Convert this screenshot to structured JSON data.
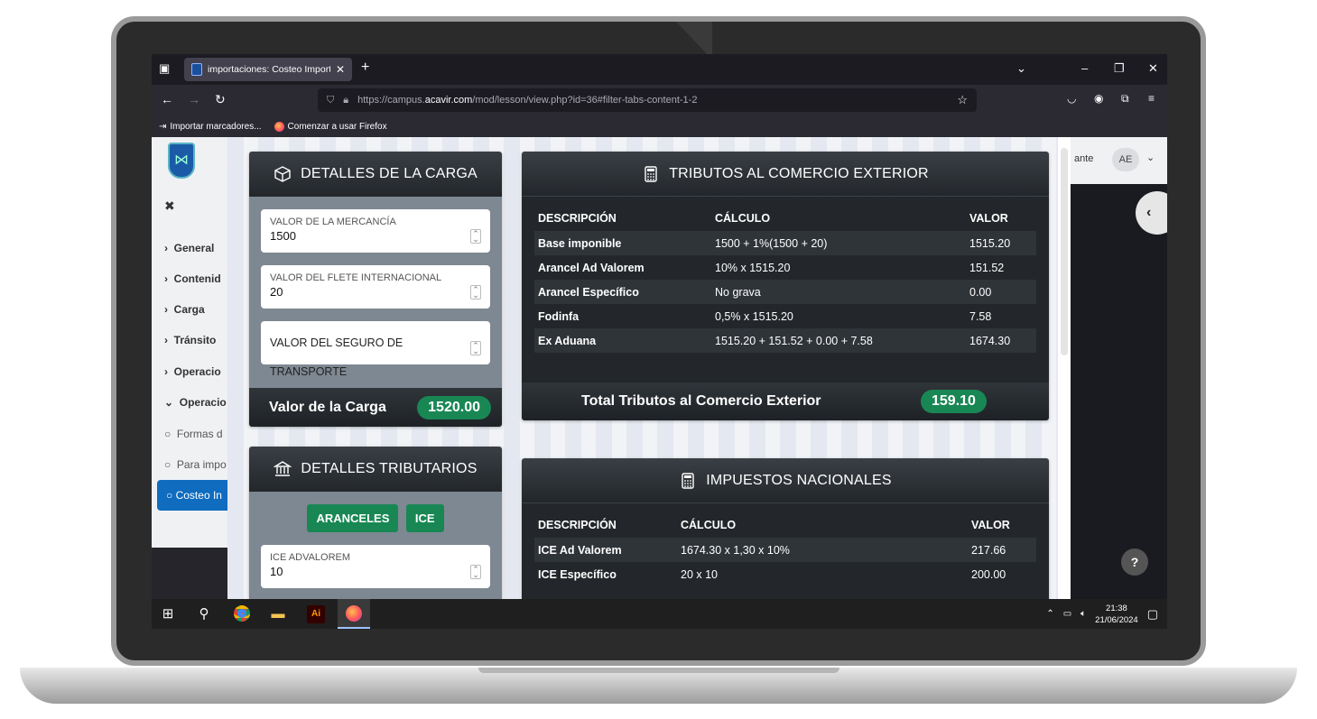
{
  "browser": {
    "tab_title": "importaciones: Costeo Importa",
    "url_prefix": "https://campus.",
    "url_host": "acavir.com",
    "url_path": "/mod/lesson/view.php?id=36#filter-tabs-content-1-2",
    "bookmarks": [
      "Importar marcadores...",
      "Comenzar a usar Firefox"
    ]
  },
  "moodle": {
    "menu": [
      {
        "label": "General"
      },
      {
        "label": "Contenid"
      },
      {
        "label": "Carga"
      },
      {
        "label": "Tránsito"
      },
      {
        "label": "Operacio"
      },
      {
        "label": "Operacio"
      }
    ],
    "submenu": [
      "Formas d",
      "Para impo"
    ],
    "active_item": "Costeo In",
    "user_role_fragment": "ante",
    "avatar": "AE"
  },
  "carga": {
    "title": "DETALLES DE LA CARGA",
    "fields": [
      {
        "label": "VALOR DE LA MERCANCÍA",
        "value": "1500"
      },
      {
        "label": "VALOR DEL FLETE INTERNACIONAL",
        "value": "20"
      }
    ],
    "seguro_placeholder": "VALOR DEL SEGURO DE TRANSPORTE",
    "total_label": "Valor de la Carga",
    "total_value": "1520.00"
  },
  "tributarios": {
    "title": "DETALLES TRIBUTARIOS",
    "buttons": [
      "ARANCELES",
      "ICE"
    ],
    "field": {
      "label": "ICE ADVALOREM",
      "value": "10"
    }
  },
  "tributos_exterior": {
    "title": "TRIBUTOS AL COMERCIO EXTERIOR",
    "headers": [
      "DESCRIPCIÓN",
      "CÁLCULO",
      "VALOR"
    ],
    "rows": [
      [
        "Base imponible",
        "1500 + 1%(1500 + 20)",
        "1515.20"
      ],
      [
        "Arancel Ad Valorem",
        "10% x 1515.20",
        "151.52"
      ],
      [
        "Arancel Específico",
        "No grava",
        "0.00"
      ],
      [
        "Fodinfa",
        "0,5% x 1515.20",
        "7.58"
      ],
      [
        "Ex Aduana",
        "1515.20 + 151.52 + 0.00 + 7.58",
        "1674.30"
      ]
    ],
    "total_label": "Total Tributos al Comercio Exterior",
    "total_value": "159.10"
  },
  "impuestos_nacionales": {
    "title": "IMPUESTOS NACIONALES",
    "headers": [
      "DESCRIPCIÓN",
      "CÁLCULO",
      "VALOR"
    ],
    "rows": [
      [
        "ICE Ad Valorem",
        "1674.30 x 1,30 x 10%",
        "217.66"
      ],
      [
        "ICE Específico",
        "20 x 10",
        "200.00"
      ]
    ]
  },
  "taskbar": {
    "time": "21:38",
    "date": "21/06/2024",
    "ai_label": "Ai"
  },
  "help_label": "?"
}
